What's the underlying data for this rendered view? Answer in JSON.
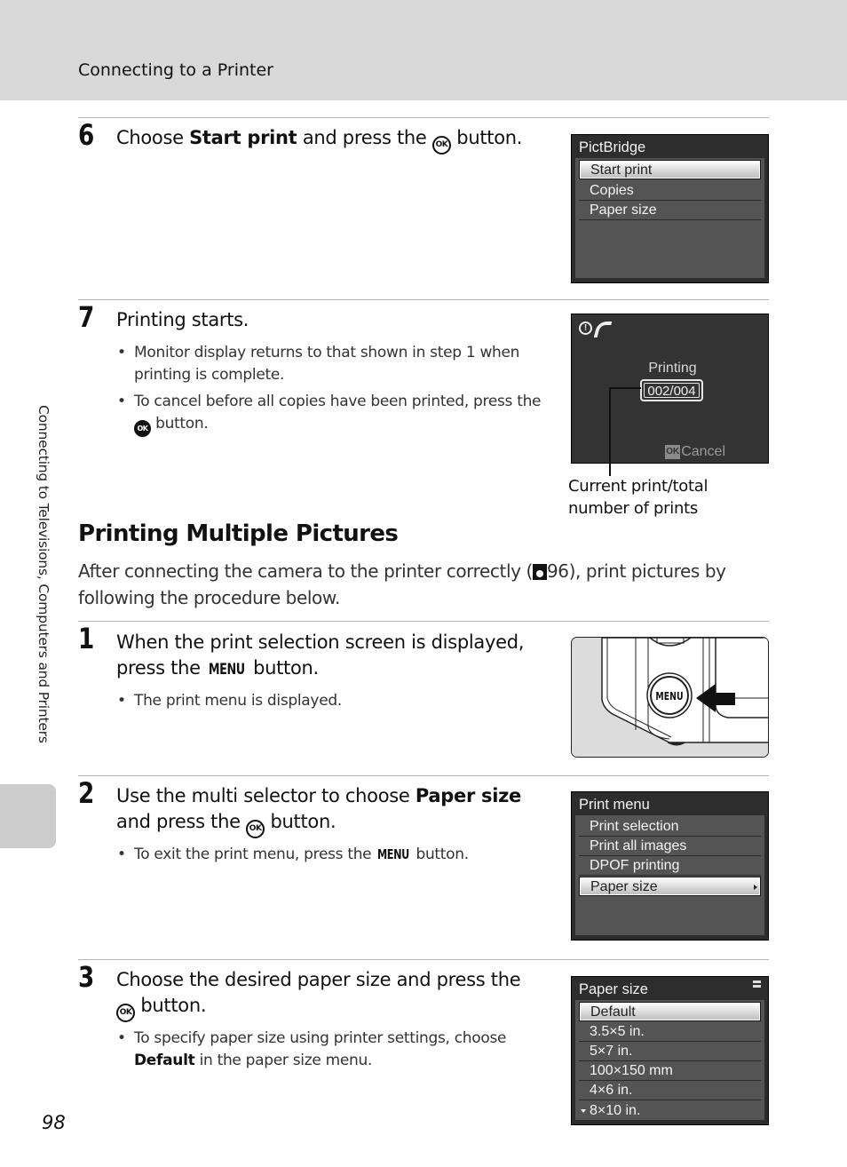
{
  "header": {
    "title": "Connecting to a Printer"
  },
  "side_tab": {
    "label": "Connecting to Televisions, Computers and Printers"
  },
  "page_number": "98",
  "steps_top": [
    {
      "number": "6",
      "text_pre": "Choose ",
      "text_bold": "Start print",
      "text_mid": " and press the ",
      "text_post": " button.",
      "icon": "ok-button-icon",
      "screen": {
        "title": "PictBridge",
        "items": [
          {
            "label": "Start print",
            "selected": true
          },
          {
            "label": "Copies",
            "selected": false
          },
          {
            "label": "Paper size",
            "selected": false
          }
        ]
      }
    },
    {
      "number": "7",
      "text": "Printing starts.",
      "bullets": [
        "Monitor display returns to that shown in step 1 when printing is complete.",
        {
          "pre": "To cancel before all copies have been printed, press the ",
          "post": " button."
        }
      ],
      "screen": {
        "status_label": "Printing",
        "counter": "002/004",
        "cancel_key": "OK",
        "cancel_label": "Cancel",
        "icons": [
          "warning-icon",
          "pictbridge-icon"
        ]
      },
      "callout": "Current print/total number of prints"
    }
  ],
  "section": {
    "title": "Printing Multiple Pictures",
    "intro_pre": "After connecting the camera to the printer correctly (",
    "intro_ref": "96",
    "intro_post": "), print pictures by following the procedure below."
  },
  "steps_bottom": [
    {
      "number": "1",
      "text_pre": "When the print selection screen is displayed, press the ",
      "menu_glyph": "MENU",
      "text_post": " button.",
      "bullets": [
        "The print menu is displayed."
      ],
      "illustration": {
        "button_label": "MENU"
      }
    },
    {
      "number": "2",
      "text_pre": "Use the multi selector to choose ",
      "text_bold": "Paper size",
      "text_mid": " and press the ",
      "text_post": " button.",
      "bullets": [
        {
          "pre": "To exit the print menu, press the ",
          "glyph": "MENU",
          "post": " button."
        }
      ],
      "screen": {
        "title": "Print menu",
        "items": [
          {
            "label": "Print selection",
            "selected": false
          },
          {
            "label": "Print all images",
            "selected": false
          },
          {
            "label": "DPOF printing",
            "selected": false
          },
          {
            "label": "Paper size",
            "selected": true
          }
        ]
      }
    },
    {
      "number": "3",
      "text_pre": "Choose the desired paper size and press the ",
      "text_post": " button.",
      "bullets": [
        {
          "pre": "To specify paper size using printer settings, choose ",
          "bold": "Default",
          "post": " in the paper size menu."
        }
      ],
      "screen": {
        "title": "Paper size",
        "items": [
          {
            "label": "Default",
            "selected": true
          },
          {
            "label": "3.5×5 in.",
            "selected": false
          },
          {
            "label": "5×7 in.",
            "selected": false
          },
          {
            "label": "100×150 mm",
            "selected": false
          },
          {
            "label": "4×6 in.",
            "selected": false
          },
          {
            "label": "8×10 in.",
            "selected": false
          }
        ]
      }
    }
  ],
  "glyphs": {
    "ok": "OK",
    "menu": "MENU"
  }
}
